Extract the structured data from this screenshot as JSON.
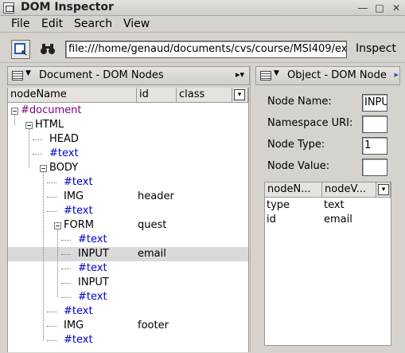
{
  "window": {
    "title": "DOM Inspector",
    "controls": [
      "minimize-icon",
      "maximize-icon",
      "close-icon"
    ]
  },
  "menubar": {
    "items": [
      "File",
      "Edit",
      "Search",
      "View"
    ]
  },
  "toolbar": {
    "url": "file:///home/genaud/documents/cvs/course/MSI409/ex",
    "inspect_label": "Inspect"
  },
  "left_panel": {
    "title": "Document - DOM Nodes",
    "columns": [
      "nodeName",
      "id",
      "class"
    ],
    "rows": [
      {
        "label": "#document",
        "id": "",
        "kind": "doc",
        "indent": 0,
        "twisty": true
      },
      {
        "label": "HTML",
        "id": "",
        "kind": "el",
        "indent": 1,
        "twisty": true
      },
      {
        "label": "HEAD",
        "id": "",
        "kind": "el",
        "indent": 2,
        "twisty": false
      },
      {
        "label": "#text",
        "id": "",
        "kind": "text",
        "indent": 2,
        "twisty": false
      },
      {
        "label": "BODY",
        "id": "",
        "kind": "el",
        "indent": 2,
        "twisty": true
      },
      {
        "label": "#text",
        "id": "",
        "kind": "text",
        "indent": 3,
        "twisty": false
      },
      {
        "label": "IMG",
        "id": "header",
        "kind": "el",
        "indent": 3,
        "twisty": false
      },
      {
        "label": "#text",
        "id": "",
        "kind": "text",
        "indent": 3,
        "twisty": false
      },
      {
        "label": "FORM",
        "id": "quest",
        "kind": "el",
        "indent": 3,
        "twisty": true
      },
      {
        "label": "#text",
        "id": "",
        "kind": "text",
        "indent": 4,
        "twisty": false
      },
      {
        "label": "INPUT",
        "id": "email",
        "kind": "el",
        "indent": 4,
        "twisty": false,
        "selected": true
      },
      {
        "label": "#text",
        "id": "",
        "kind": "text",
        "indent": 4,
        "twisty": false
      },
      {
        "label": "INPUT",
        "id": "",
        "kind": "el",
        "indent": 4,
        "twisty": false
      },
      {
        "label": "#text",
        "id": "",
        "kind": "text",
        "indent": 4,
        "twisty": false
      },
      {
        "label": "#text",
        "id": "",
        "kind": "text",
        "indent": 3,
        "twisty": false
      },
      {
        "label": "IMG",
        "id": "footer",
        "kind": "el",
        "indent": 3,
        "twisty": false
      },
      {
        "label": "#text",
        "id": "",
        "kind": "text",
        "indent": 3,
        "twisty": false
      }
    ]
  },
  "right_panel": {
    "title": "Object - DOM Node",
    "fields": [
      {
        "label": "Node Name:",
        "value": "INPUT"
      },
      {
        "label": "Namespace URI:",
        "value": ""
      },
      {
        "label": "Node Type:",
        "value": "1"
      },
      {
        "label": "Node Value:",
        "value": ""
      }
    ],
    "attr_columns": [
      "nodeN...",
      "nodeV..."
    ],
    "attributes": [
      {
        "name": "type",
        "value": "text"
      },
      {
        "name": "id",
        "value": "email"
      }
    ]
  }
}
